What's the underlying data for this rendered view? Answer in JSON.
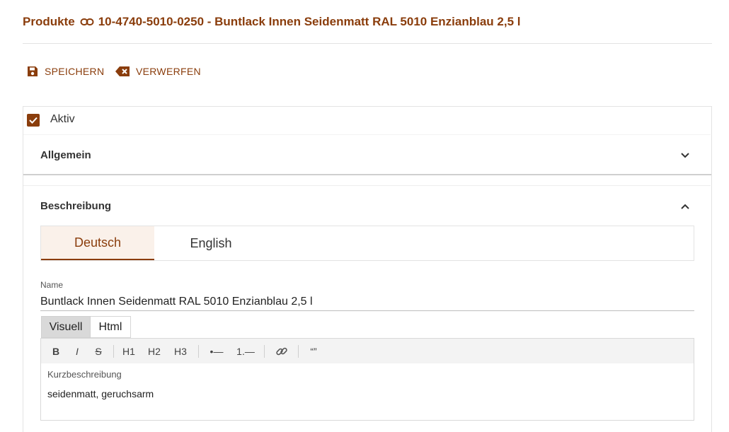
{
  "header": {
    "breadcrumb": "Produkte",
    "product_title": "10-4740-5010-0250 - Buntlack Innen Seidenmatt RAL 5010 Enzianblau 2,5 l",
    "link_icon": "link-icon"
  },
  "toolbar": {
    "save_label": "SPEICHERN",
    "save_icon": "floppy-disk-icon",
    "discard_label": "VERWERFEN",
    "discard_icon": "backspace-x-icon"
  },
  "active": {
    "label": "Aktiv",
    "checked": true
  },
  "sections": {
    "general": {
      "title": "Allgemein",
      "expanded": false
    },
    "description": {
      "title": "Beschreibung",
      "expanded": true
    }
  },
  "language_tabs": [
    {
      "label": "Deutsch",
      "selected": true
    },
    {
      "label": "English",
      "selected": false
    }
  ],
  "name_field": {
    "label": "Name",
    "value": "Buntlack Innen Seidenmatt RAL 5010 Enzianblau 2,5 l"
  },
  "editor": {
    "mode_tabs": [
      {
        "label": "Visuell",
        "selected": true
      },
      {
        "label": "Html",
        "selected": false
      }
    ],
    "tools": {
      "bold": "B",
      "italic": "I",
      "strike": "S",
      "h1": "H1",
      "h2": "H2",
      "h3": "H3",
      "bullet_list": "•—",
      "ordered_list": "1.—",
      "quote": "“”"
    },
    "placeholder": "Kurzbeschreibung",
    "content": "seidenmatt, geruchsarm"
  },
  "colors": {
    "accent": "#8a3d0c",
    "tab_active_bg": "#faf1ea",
    "toolbar_bg": "#f3f3f3"
  }
}
